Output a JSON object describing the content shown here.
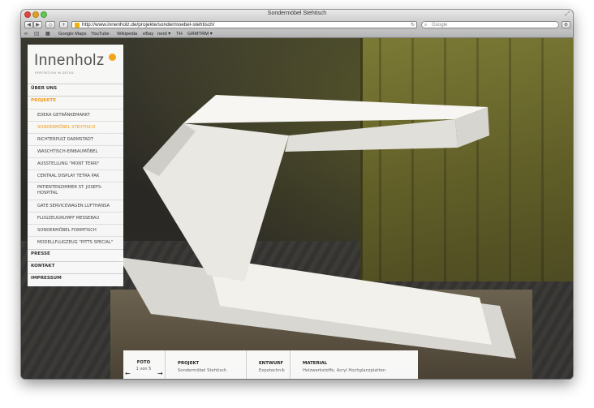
{
  "window": {
    "title": "Sondermöbel Stehtisch"
  },
  "toolbar": {
    "url": "http://www.innenholz.de/projekte/sondermoebel-stehtisch/",
    "search_placeholder": "Google",
    "add_label": "+"
  },
  "bookmarks": [
    {
      "label": "Google Maps"
    },
    {
      "label": "YouTube"
    },
    {
      "label": "Wikipedia"
    },
    {
      "label": "eBay"
    },
    {
      "label": "nerd ▾"
    },
    {
      "label": "TH"
    },
    {
      "label": "GRMTRM ▾"
    }
  ],
  "sidebar": {
    "logo": "Innenholz",
    "tagline": "PERFEKTION IN DETAIL",
    "main": {
      "ueber_uns": "ÜBER UNS",
      "projekte": "PROJEKTE",
      "presse": "PRESSE",
      "kontakt": "KONTAKT",
      "impressum": "IMPRESSUM"
    },
    "projects": [
      {
        "label": "EDEKA GETRÄNKEMARKT"
      },
      {
        "label": "SONDERMÖBEL STEHTISCH"
      },
      {
        "label": "RICHTERPULT DARMSTADT"
      },
      {
        "label": "WASCHTISCH-EINBAUMÖBEL"
      },
      {
        "label": "AUSSTELLUNG \"MONT TERRI\""
      },
      {
        "label": "CENTRAL DISPLAY TETRA PAK"
      },
      {
        "label": "PATIENTENZIMMER ST. JOSEFS-HOSPITAL"
      },
      {
        "label": "GATE SERVICEWAGEN LUFTHANSA"
      },
      {
        "label": "FLUGZEUGRUMPF MESSEBAU"
      },
      {
        "label": "SONDERMÖBEL FORMTISCH"
      },
      {
        "label": "MODELLFLUGZEUG \"PITTS SPECIAL\""
      }
    ]
  },
  "info": {
    "foto_label": "FOTO",
    "foto_count": "1 von 5",
    "prev": "←",
    "next": "→",
    "projekt_label": "PROJEKT",
    "projekt_value": "Sondermöbel Stehtisch",
    "entwurf_label": "ENTWURF",
    "entwurf_value": "Expotechnik",
    "material_label": "MATERIAL",
    "material_value": "Holzwerkstoffe, Acryl Hochglanzplatten"
  },
  "colors": {
    "accent": "#f09a1a",
    "container": "#6e6c2e"
  }
}
